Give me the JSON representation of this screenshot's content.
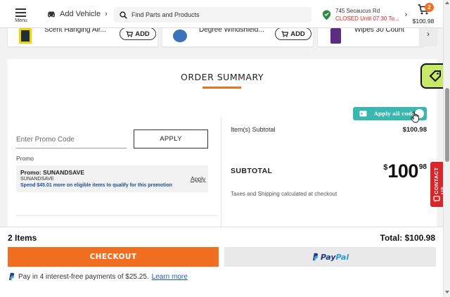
{
  "header": {
    "menu_label": "Menu",
    "add_vehicle_label": "Add Vehicle",
    "search_placeholder": "Find Parts and Products",
    "store_address": "745 Secaucus Rd",
    "store_status": "CLOSED Until 07:30 To...",
    "cart_count": "2",
    "cart_total": "$100.98"
  },
  "products": [
    {
      "name_line1": "",
      "name_line2": "Scent Hanging Air...",
      "add_label": "ADD"
    },
    {
      "name_line1": "",
      "name_line2": "Degree Windshield...",
      "add_label": "ADD"
    },
    {
      "name_line1": "",
      "name_line2": "Wipes 30 Count"
    }
  ],
  "order_summary": {
    "title": "ORDER SUMMARY",
    "promo_placeholder": "Enter Promo Code",
    "apply_button": "APPLY",
    "promo_section_label": "Promo",
    "promo_title": "Promo: SUNANDSAVE",
    "promo_code": "SUNANDSAVE",
    "promo_requirement": "Spend $45.01 more on eligible items to qualify for this promotion",
    "promo_apply_link": "Apply",
    "apply_all_codes": "Apply all codes",
    "items_subtotal_label": "Item(s) Subtotal",
    "items_subtotal_value": "$100.98",
    "subtotal_label": "SUBTOTAL",
    "subtotal_currency": "$",
    "subtotal_whole": "100",
    "subtotal_cents": "98",
    "tax_note": "Taxes and Shipping calculated at checkout"
  },
  "contact_tab_label": "CONTACT US",
  "bottom_bar": {
    "items_count": "2 Items",
    "total_label": "Total: $100.98",
    "checkout_label": "CHECKOUT",
    "paypal_label_1": "Pay",
    "paypal_label_2": "Pal",
    "pay_in_4_text": "Pay in 4 interest-free payments of $25.25.",
    "learn_more": "Learn more"
  },
  "colors": {
    "accent_orange": "#f26f21",
    "teal": "#3ab7ae",
    "closed_red": "#d61f1f",
    "paypal_navy": "#1f3a7d",
    "paypal_blue": "#2b9ad8"
  }
}
